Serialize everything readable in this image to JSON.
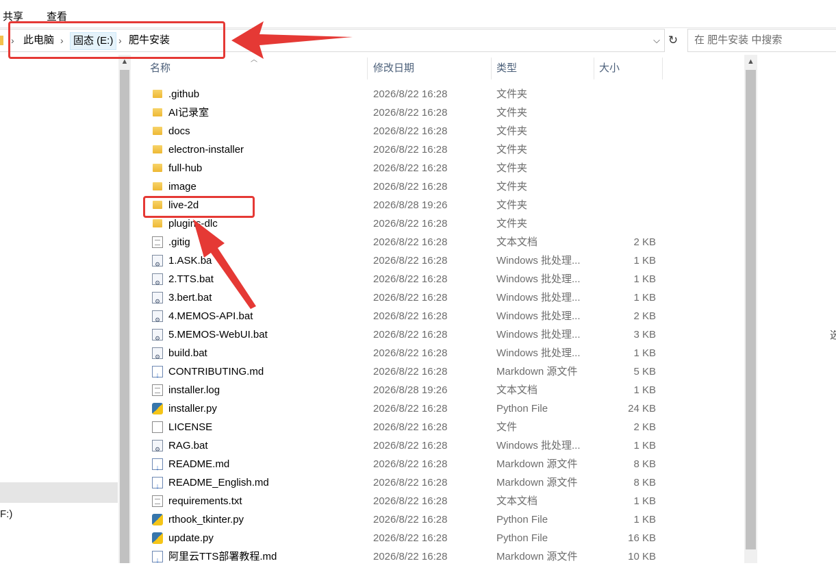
{
  "menu": {
    "share": "共享",
    "view": "查看"
  },
  "breadcrumb": {
    "pc": "此电脑",
    "drive": "固态 (E:)",
    "folder": "肥牛安装"
  },
  "search": {
    "placeholder": "在 肥牛安装 中搜索"
  },
  "nav": {
    "drive_partial": "F:)"
  },
  "edge_char": "选",
  "columns": {
    "name": "名称",
    "date": "修改日期",
    "type": "类型",
    "size": "大小"
  },
  "files": [
    {
      "icon": "folder-icon",
      "name": ".github",
      "date": "2026/8/22 16:28",
      "type": "文件夹",
      "size": ""
    },
    {
      "icon": "folder-icon",
      "name": "AI记录室",
      "date": "2026/8/22 16:28",
      "type": "文件夹",
      "size": ""
    },
    {
      "icon": "folder-icon",
      "name": "docs",
      "date": "2026/8/22 16:28",
      "type": "文件夹",
      "size": ""
    },
    {
      "icon": "folder-icon",
      "name": "electron-installer",
      "date": "2026/8/22 16:28",
      "type": "文件夹",
      "size": ""
    },
    {
      "icon": "folder-icon",
      "name": "full-hub",
      "date": "2026/8/22 16:28",
      "type": "文件夹",
      "size": ""
    },
    {
      "icon": "folder-icon",
      "name": "image",
      "date": "2026/8/22 16:28",
      "type": "文件夹",
      "size": ""
    },
    {
      "icon": "folder-icon",
      "name": "live-2d",
      "date": "2026/8/28 19:26",
      "type": "文件夹",
      "size": ""
    },
    {
      "icon": "folder-icon",
      "name": "plugins-dlc",
      "date": "2026/8/22 16:28",
      "type": "文件夹",
      "size": ""
    },
    {
      "icon": "text-file-icon",
      "name": ".gitig",
      "date": "2026/8/22 16:28",
      "type": "文本文档",
      "size": "2 KB"
    },
    {
      "icon": "batch-file-icon",
      "name": "1.ASK.ba",
      "date": "2026/8/22 16:28",
      "type": "Windows 批处理...",
      "size": "1 KB"
    },
    {
      "icon": "batch-file-icon",
      "name": "2.TTS.bat",
      "date": "2026/8/22 16:28",
      "type": "Windows 批处理...",
      "size": "1 KB"
    },
    {
      "icon": "batch-file-icon",
      "name": "3.bert.bat",
      "date": "2026/8/22 16:28",
      "type": "Windows 批处理...",
      "size": "1 KB"
    },
    {
      "icon": "batch-file-icon",
      "name": "4.MEMOS-API.bat",
      "date": "2026/8/22 16:28",
      "type": "Windows 批处理...",
      "size": "2 KB"
    },
    {
      "icon": "batch-file-icon",
      "name": "5.MEMOS-WebUI.bat",
      "date": "2026/8/22 16:28",
      "type": "Windows 批处理...",
      "size": "3 KB"
    },
    {
      "icon": "batch-file-icon",
      "name": "build.bat",
      "date": "2026/8/22 16:28",
      "type": "Windows 批处理...",
      "size": "1 KB"
    },
    {
      "icon": "markdown-file-icon",
      "name": "CONTRIBUTING.md",
      "date": "2026/8/22 16:28",
      "type": "Markdown 源文件",
      "size": "5 KB"
    },
    {
      "icon": "text-file-icon",
      "name": "installer.log",
      "date": "2026/8/28 19:26",
      "type": "文本文档",
      "size": "1 KB"
    },
    {
      "icon": "python-file-icon",
      "name": "installer.py",
      "date": "2026/8/22 16:28",
      "type": "Python File",
      "size": "24 KB"
    },
    {
      "icon": "blank-file-icon",
      "name": "LICENSE",
      "date": "2026/8/22 16:28",
      "type": "文件",
      "size": "2 KB"
    },
    {
      "icon": "batch-file-icon",
      "name": "RAG.bat",
      "date": "2026/8/22 16:28",
      "type": "Windows 批处理...",
      "size": "1 KB"
    },
    {
      "icon": "markdown-file-icon",
      "name": "README.md",
      "date": "2026/8/22 16:28",
      "type": "Markdown 源文件",
      "size": "8 KB"
    },
    {
      "icon": "markdown-file-icon",
      "name": "README_English.md",
      "date": "2026/8/22 16:28",
      "type": "Markdown 源文件",
      "size": "8 KB"
    },
    {
      "icon": "text-file-icon",
      "name": "requirements.txt",
      "date": "2026/8/22 16:28",
      "type": "文本文档",
      "size": "1 KB"
    },
    {
      "icon": "python-file-icon",
      "name": "rthook_tkinter.py",
      "date": "2026/8/22 16:28",
      "type": "Python File",
      "size": "1 KB"
    },
    {
      "icon": "python-file-icon",
      "name": "update.py",
      "date": "2026/8/22 16:28",
      "type": "Python File",
      "size": "16 KB"
    },
    {
      "icon": "markdown-file-icon",
      "name": "阿里云TTS部署教程.md",
      "date": "2026/8/22 16:28",
      "type": "Markdown 源文件",
      "size": "10 KB"
    }
  ],
  "colors": {
    "annotation": "#e53935",
    "folder": "#eeb834"
  }
}
